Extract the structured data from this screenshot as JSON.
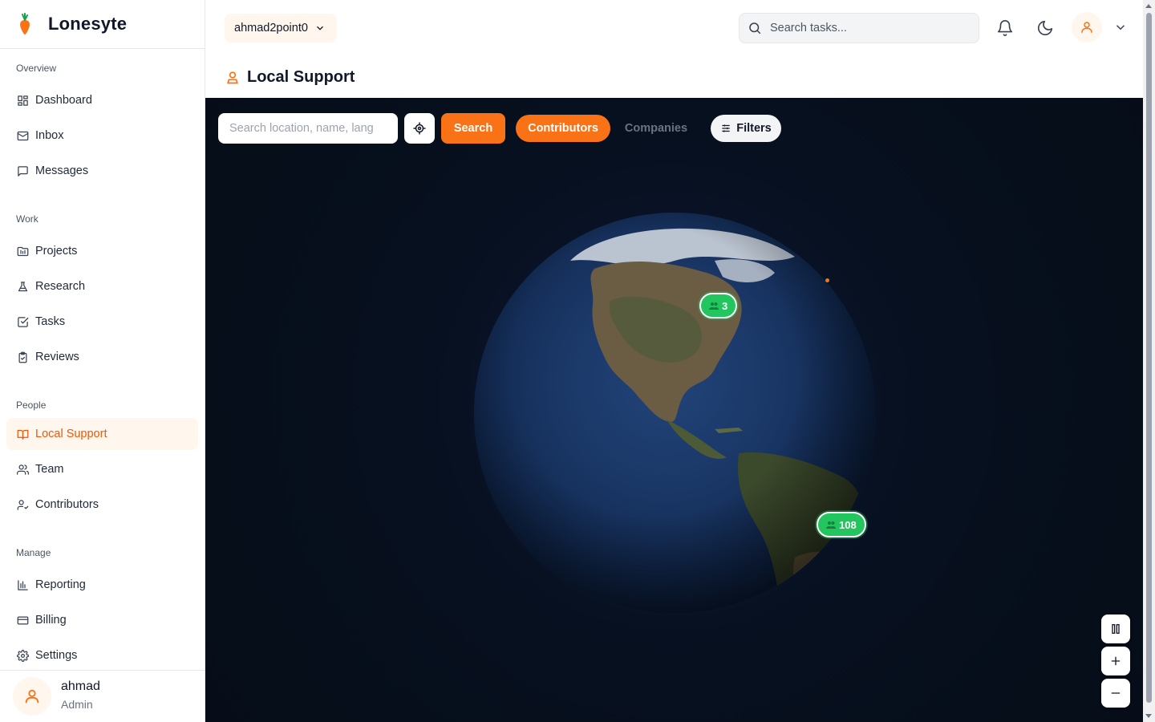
{
  "brand": {
    "name": "Lonesyte"
  },
  "sidebar": {
    "sections": [
      {
        "title": "Overview",
        "items": [
          {
            "label": "Dashboard",
            "icon": "dashboard-icon"
          },
          {
            "label": "Inbox",
            "icon": "mail-icon"
          },
          {
            "label": "Messages",
            "icon": "message-icon"
          }
        ]
      },
      {
        "title": "Work",
        "items": [
          {
            "label": "Projects",
            "icon": "folder-icon"
          },
          {
            "label": "Research",
            "icon": "flask-icon"
          },
          {
            "label": "Tasks",
            "icon": "checkbox-icon"
          },
          {
            "label": "Reviews",
            "icon": "clipboard-icon"
          }
        ]
      },
      {
        "title": "People",
        "items": [
          {
            "label": "Local Support",
            "icon": "book-icon",
            "active": true
          },
          {
            "label": "Team",
            "icon": "users-icon"
          },
          {
            "label": "Contributors",
            "icon": "user-check-icon"
          }
        ]
      },
      {
        "title": "Manage",
        "items": [
          {
            "label": "Reporting",
            "icon": "bar-chart-icon"
          },
          {
            "label": "Billing",
            "icon": "credit-card-icon"
          },
          {
            "label": "Settings",
            "icon": "gear-icon"
          }
        ]
      }
    ],
    "user": {
      "name": "ahmad",
      "role": "Admin"
    }
  },
  "topbar": {
    "org": "ahmad2point0",
    "search_placeholder": "Search tasks..."
  },
  "page": {
    "title": "Local Support"
  },
  "map": {
    "search_placeholder": "Search location, name, language...",
    "search_button": "Search",
    "tabs": {
      "contributors": "Contributors",
      "companies": "Companies",
      "active": "contributors"
    },
    "filters_button": "Filters",
    "clusters": [
      {
        "count": "3",
        "region": "North America"
      },
      {
        "count": "108",
        "region": "South America"
      }
    ],
    "accent_color": "#f97316",
    "cluster_color": "#22c55e"
  }
}
